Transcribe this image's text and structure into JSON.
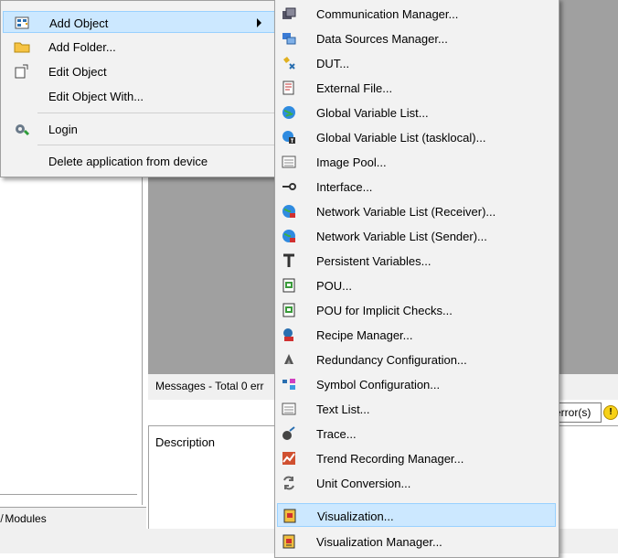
{
  "context_menu": {
    "items": [
      {
        "label": "Add Object",
        "icon": "add-object-icon",
        "highlighted": true,
        "has_submenu": true
      },
      {
        "label": "Add Folder...",
        "icon": "folder-icon"
      },
      {
        "label": "Edit Object",
        "icon": "edit-object-icon"
      },
      {
        "label": "Edit Object With..."
      },
      {
        "label": "Login",
        "icon": "login-icon"
      },
      {
        "label": "Delete application from device"
      }
    ]
  },
  "submenu": {
    "items": [
      {
        "label": "Communication Manager...",
        "icon": "communication-manager-icon"
      },
      {
        "label": "Data Sources Manager...",
        "icon": "data-sources-icon"
      },
      {
        "label": "DUT...",
        "icon": "dut-icon"
      },
      {
        "label": "External File...",
        "icon": "external-file-icon"
      },
      {
        "label": "Global Variable List...",
        "icon": "globe-icon"
      },
      {
        "label": "Global Variable List (tasklocal)...",
        "icon": "globe-task-icon"
      },
      {
        "label": "Image Pool...",
        "icon": "image-pool-icon"
      },
      {
        "label": "Interface...",
        "icon": "interface-icon"
      },
      {
        "label": "Network Variable List (Receiver)...",
        "icon": "network-receiver-icon"
      },
      {
        "label": "Network Variable List (Sender)...",
        "icon": "network-sender-icon"
      },
      {
        "label": "Persistent Variables...",
        "icon": "persistent-icon"
      },
      {
        "label": "POU...",
        "icon": "pou-icon"
      },
      {
        "label": "POU for Implicit Checks...",
        "icon": "pou-checks-icon"
      },
      {
        "label": "Recipe Manager...",
        "icon": "recipe-icon"
      },
      {
        "label": "Redundancy Configuration...",
        "icon": "redundancy-icon"
      },
      {
        "label": "Symbol Configuration...",
        "icon": "symbol-icon"
      },
      {
        "label": "Text List...",
        "icon": "text-list-icon"
      },
      {
        "label": "Trace...",
        "icon": "trace-icon"
      },
      {
        "label": "Trend Recording Manager...",
        "icon": "trend-icon"
      },
      {
        "label": "Unit Conversion...",
        "icon": "unit-conversion-icon"
      },
      {
        "label": "Visualization...",
        "icon": "visualization-icon",
        "highlighted": true
      },
      {
        "label": "Visualization Manager...",
        "icon": "visualization-manager-icon"
      }
    ]
  },
  "messages": {
    "header": "Messages - Total 0 err",
    "errors_filter": "error(s)",
    "description_header": "Description"
  },
  "left_panel": {
    "modules_tab": "̸ Modules"
  },
  "colors": {
    "highlight_bg": "#cce8ff",
    "highlight_border": "#99d1ff",
    "editor_gray": "#a0a0a0",
    "menu_bg": "#f2f2f2"
  }
}
